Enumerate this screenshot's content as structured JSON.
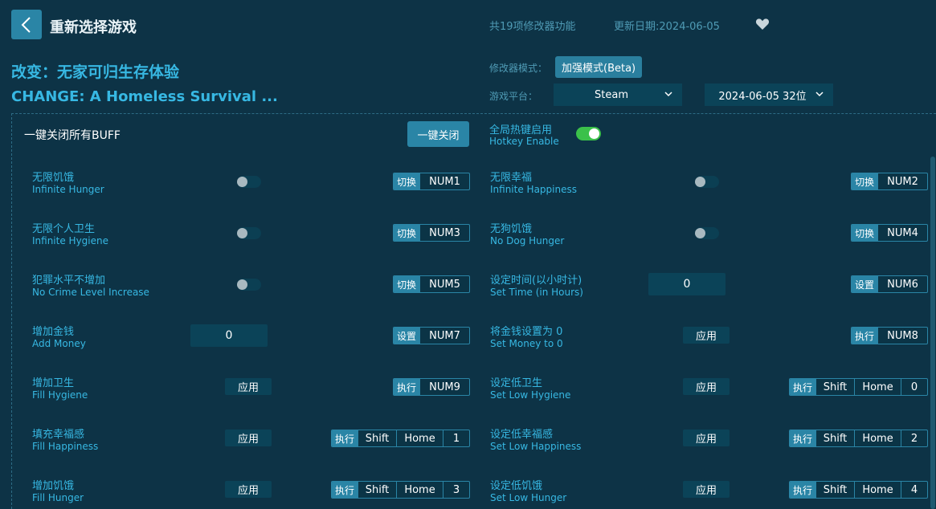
{
  "header": {
    "back_label": "重新选择游戏",
    "feature_count": "共19项修改器功能",
    "update_date": "更新日期:2024-06-05"
  },
  "game": {
    "name_cn": "改变：无家可归生存体验",
    "name_en": "CHANGE: A Homeless Survival ..."
  },
  "mode": {
    "label": "修改器模式：",
    "value": "加强模式(Beta)"
  },
  "platform": {
    "label": "游戏平台：",
    "value": "Steam",
    "version": "2024-06-05 32位"
  },
  "global": {
    "disable_all_label": "一键关闭所有BUFF",
    "disable_all_button": "一键关闭",
    "hotkey_cn": "全局热键启用",
    "hotkey_en": "Hotkey Enable"
  },
  "features": {
    "f1": {
      "cn": "无限饥饿",
      "en": "Infinite Hunger",
      "act": "切换",
      "k1": "NUM1"
    },
    "f2": {
      "cn": "无限幸福",
      "en": "Infinite Happiness",
      "act": "切换",
      "k1": "NUM2"
    },
    "f3": {
      "cn": "无限个人卫生",
      "en": "Infinite Hygiene",
      "act": "切换",
      "k1": "NUM3"
    },
    "f4": {
      "cn": "无狗饥饿",
      "en": "No Dog Hunger",
      "act": "切换",
      "k1": "NUM4"
    },
    "f5": {
      "cn": "犯罪水平不增加",
      "en": "No Crime Level Increase",
      "act": "切换",
      "k1": "NUM5"
    },
    "f6": {
      "cn": "设定时间(以小时计)",
      "en": "Set Time (in Hours)",
      "act": "设置",
      "k1": "NUM6",
      "value": "0"
    },
    "f7": {
      "cn": "增加金钱",
      "en": "Add Money",
      "act": "设置",
      "k1": "NUM7",
      "value": "0"
    },
    "f8": {
      "cn": "将金钱设置为 0",
      "en": "Set Money to 0",
      "act": "执行",
      "k1": "NUM8",
      "apply": "应用"
    },
    "f9": {
      "cn": "增加卫生",
      "en": "Fill Hygiene",
      "act": "执行",
      "k1": "NUM9",
      "apply": "应用"
    },
    "f10": {
      "cn": "设定低卫生",
      "en": "Set Low Hygiene",
      "act": "执行",
      "k1": "Shift",
      "k2": "Home",
      "k3": "0",
      "apply": "应用"
    },
    "f11": {
      "cn": "填充幸福感",
      "en": "Fill Happiness",
      "act": "执行",
      "k1": "Shift",
      "k2": "Home",
      "k3": "1",
      "apply": "应用"
    },
    "f12": {
      "cn": "设定低幸福感",
      "en": "Set Low Happiness",
      "act": "执行",
      "k1": "Shift",
      "k2": "Home",
      "k3": "2",
      "apply": "应用"
    },
    "f13": {
      "cn": "增加饥饿",
      "en": "Fill Hunger",
      "act": "执行",
      "k1": "Shift",
      "k2": "Home",
      "k3": "3",
      "apply": "应用"
    },
    "f14": {
      "cn": "设定低饥饿",
      "en": "Set Low Hunger",
      "act": "执行",
      "k1": "Shift",
      "k2": "Home",
      "k3": "4",
      "apply": "应用"
    }
  },
  "colors": {
    "background": "#0d3346",
    "accent": "#2a85a6",
    "text_blue": "#37b8e3",
    "toggle_on": "#3bc14a"
  }
}
